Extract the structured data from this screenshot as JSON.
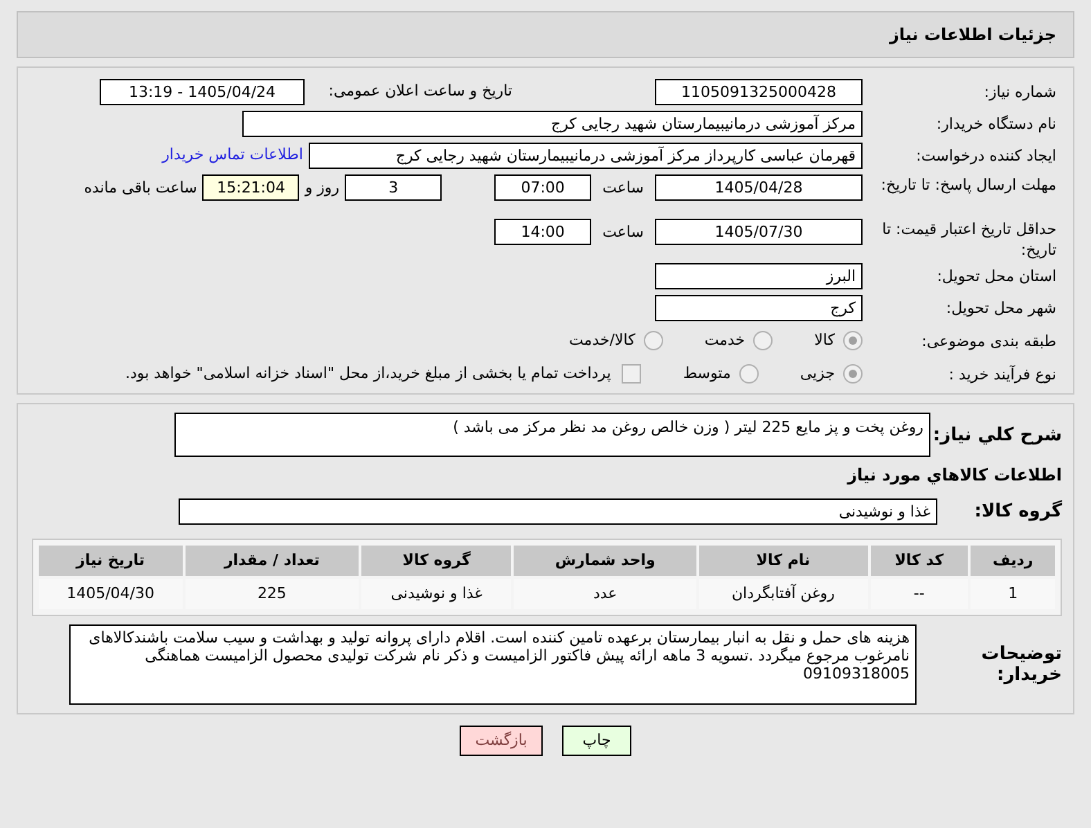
{
  "header": {
    "title": "جزئیات اطلاعات نیاز"
  },
  "need_number": {
    "label": "شماره نیاز:",
    "value": "1105091325000428"
  },
  "announce": {
    "label": "تاریخ و ساعت اعلان عمومی:",
    "value": "1405/04/24 - 13:19"
  },
  "buyer": {
    "label": "نام دستگاه خریدار:",
    "value": "مرکز آموزشی درمانیبیمارستان شهید رجایی کرج"
  },
  "creator": {
    "label": "ایجاد کننده درخواست:",
    "value": "قهرمان عباسی کارپرداز مرکز آموزشی درمانیبیمارستان شهید رجایی کرج",
    "link": "اطلاعات تماس خریدار"
  },
  "deadline": {
    "label": "مهلت ارسال پاسخ: تا تاریخ:",
    "date": "1405/04/28",
    "time_label": "ساعت",
    "time": "07:00",
    "days": "3",
    "days_label": "روز و",
    "remaining": "15:21:04",
    "remaining_label": "ساعت باقی مانده"
  },
  "validity": {
    "label": "حداقل تاریخ اعتبار قیمت: تا تاریخ:",
    "date": "1405/07/30",
    "time_label": "ساعت",
    "time": "14:00"
  },
  "province": {
    "label": "استان محل تحویل:",
    "value": "البرز"
  },
  "city": {
    "label": "شهر محل تحویل:",
    "value": "کرج"
  },
  "category": {
    "label": "طبقه بندی موضوعی:",
    "options": [
      {
        "label": "کالا",
        "selected": true
      },
      {
        "label": "خدمت",
        "selected": false
      },
      {
        "label": "کالا/خدمت",
        "selected": false
      }
    ]
  },
  "purchase_type": {
    "label": "نوع فرآیند خرید :",
    "options": [
      {
        "label": "جزیی",
        "selected": true
      },
      {
        "label": "متوسط",
        "selected": false
      }
    ],
    "treasury": {
      "label": "پرداخت تمام یا بخشی از مبلغ خرید،از محل \"اسناد خزانه اسلامی\" خواهد بود.",
      "checked": false
    }
  },
  "description": {
    "label": "شرح کلي نیاز:",
    "value": "روغن پخت و پز مایع  225 لیتر ( وزن خالص روغن مد نظر مرکز می باشد  )"
  },
  "goods_heading": "اطلاعات کالاهاي مورد نیاز",
  "goods_group": {
    "label": "گروه کالا:",
    "value": "غذا و نوشیدنی"
  },
  "table": {
    "columns": [
      "ردیف",
      "کد کالا",
      "نام کالا",
      "واحد شمارش",
      "گروه کالا",
      "تعداد / مقدار",
      "تاریخ نیاز"
    ],
    "rows": [
      [
        "1",
        "--",
        "روغن آفتابگردان",
        "عدد",
        "غذا و نوشیدنی",
        "225",
        "1405/04/30"
      ]
    ]
  },
  "notes": {
    "label": "توضیحات خریدار:",
    "value": "هزینه های حمل و نقل به انبار بیمارستان برعهده تامین کننده است. اقلام دارای پروانه تولید و بهداشت و سیب سلامت باشندکالاهای نامرغوب مرجوع میگردد .تسویه 3 ماهه ارائه پیش فاکتور الزامیست و ذکر نام شرکت تولیدی محصول الزامیست هماهنگی 09109318005"
  },
  "buttons": [
    {
      "kind": "print",
      "label": "چاپ"
    },
    {
      "kind": "back",
      "label": "بازگشت"
    }
  ]
}
